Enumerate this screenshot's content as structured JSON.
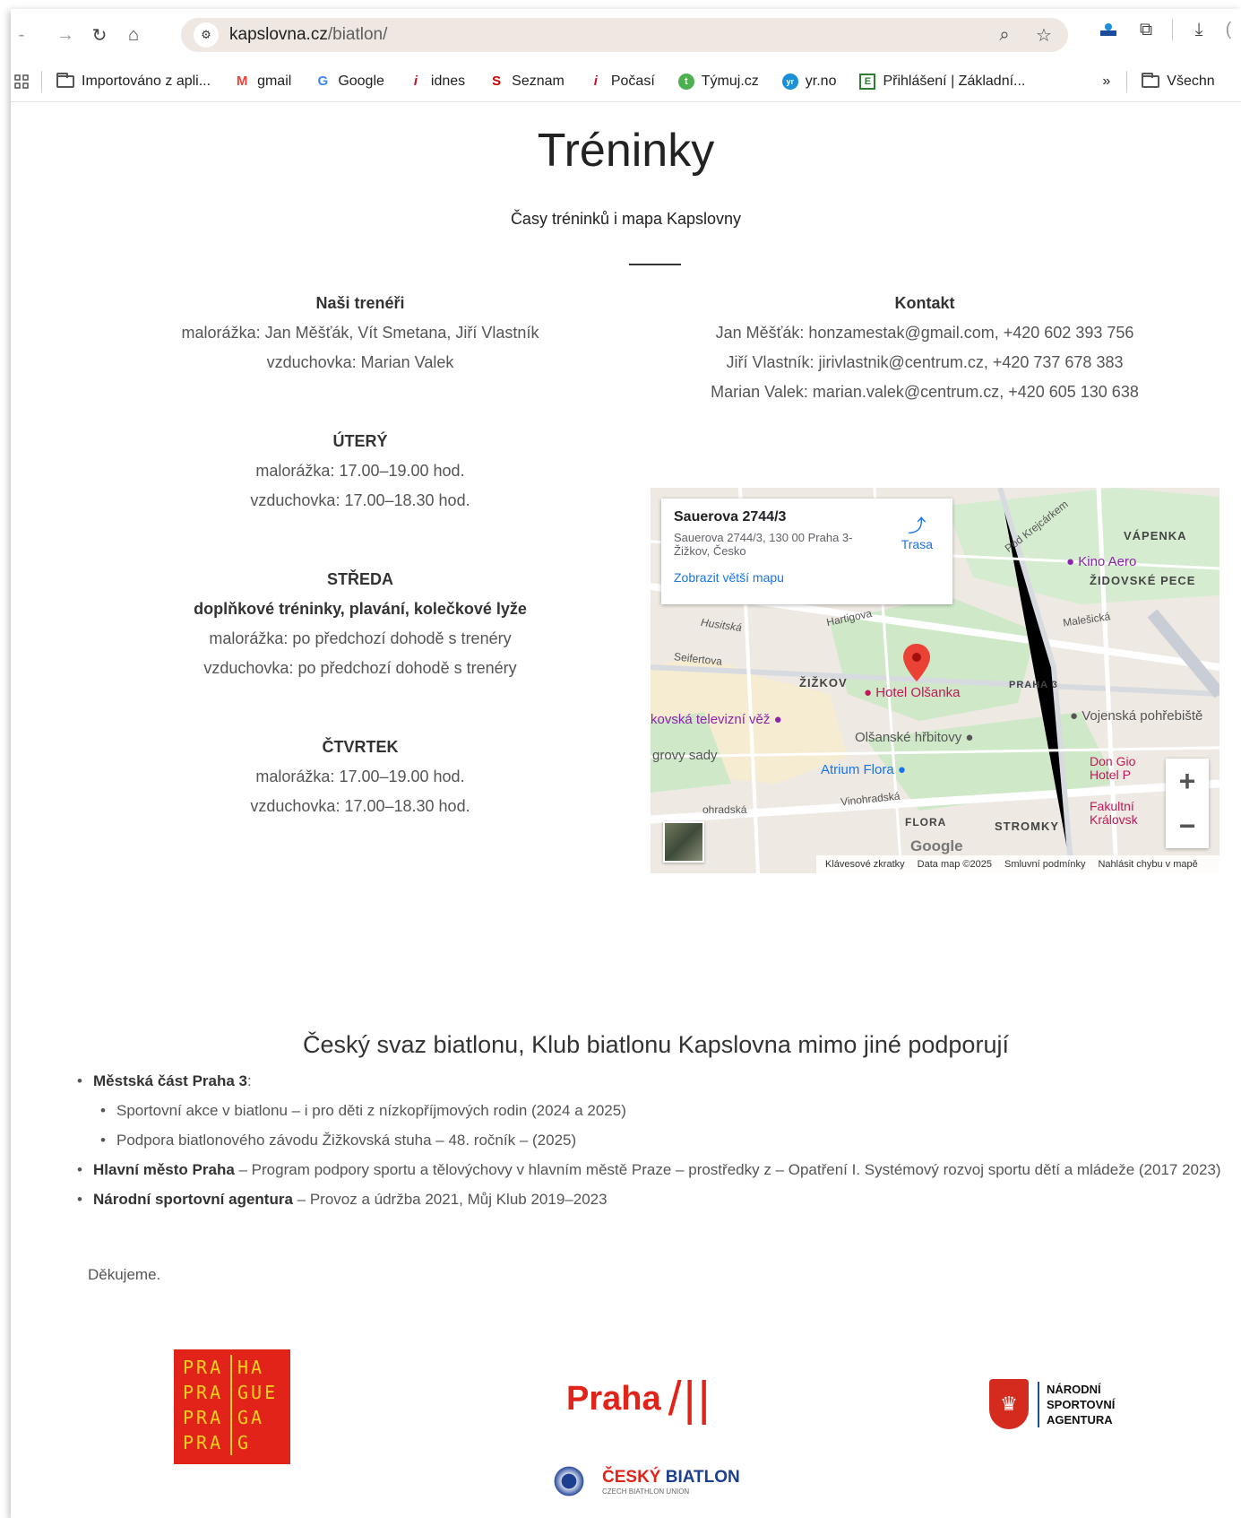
{
  "browser": {
    "url_host": "kapslovna.cz",
    "url_path": "/biatlon/",
    "bookmarks": [
      {
        "label": "Importováno z apli...",
        "icon": "folder-icon"
      },
      {
        "label": "gmail",
        "icon": "gmail-icon"
      },
      {
        "label": "Google",
        "icon": "google-icon"
      },
      {
        "label": "idnes",
        "icon": "idnes-icon"
      },
      {
        "label": "Seznam",
        "icon": "seznam-icon"
      },
      {
        "label": "Počasí",
        "icon": "pocasi-icon"
      },
      {
        "label": "Týmuj.cz",
        "icon": "tymuj-icon"
      },
      {
        "label": "yr.no",
        "icon": "yr-icon"
      },
      {
        "label": "Přihlášení | Základní...",
        "icon": "login-icon"
      }
    ],
    "more_label": "»",
    "all_bookmarks_label": "Všechn"
  },
  "page": {
    "title": "Tréninky",
    "subtitle": "Časy tréninků i mapa Kapslovny"
  },
  "trainers": {
    "heading": "Naši trenéři",
    "line1": "malorážka: Jan Měšťák, Vít Smetana, Jiří Vlastník",
    "line2": "vzduchovka: Marian Valek"
  },
  "contact": {
    "heading": "Kontakt",
    "line1": "Jan Měšťák: honzamestak@gmail.com, +420 602 393 756",
    "line2": "Jiří Vlastník: jirivlastnik@centrum.cz, +420 737 678 383",
    "line3": "Marian Valek: marian.valek@centrum.cz, +420 605 130 638"
  },
  "schedule": {
    "tuesday": {
      "heading": "ÚTERÝ",
      "line1": "malorážka: 17.00–19.00 hod.",
      "line2": "vzduchovka: 17.00–18.30 hod."
    },
    "wednesday": {
      "heading": "STŘEDA",
      "subheading": "doplňkové tréninky, plavání, kolečkové lyže",
      "line1": "malorážka: po předchozí dohodě s trenéry",
      "line2": "vzduchovka: po předchozí dohodě s trenéry"
    },
    "thursday": {
      "heading": "ČTVRTEK",
      "line1": "malorážka: 17.00–19.00 hod.",
      "line2": "vzduchovka: 17.00–18.30 hod."
    }
  },
  "map": {
    "card_title": "Sauerova 2744/3",
    "card_address": "Sauerova 2744/3, 130 00 Praha 3-Žižkov, Česko",
    "card_link": "Zobrazit větší mapu",
    "directions_label": "Trasa",
    "labels": {
      "vapenka": "VÁPENKA",
      "kino": "Kino Aero",
      "zidovske": "ŽIDOVSKÉ PECE",
      "podkrejcarkem": "Pod Krejcárkem",
      "hartigova": "Hartigova",
      "husitska": "Husitská",
      "malesicka": "Malešická",
      "seifertova": "Seifertova",
      "zizkov": "ŽIŽKOV",
      "hotel": "Hotel Olšanka",
      "praha3": "PRAHA 3",
      "tvvez": "kovská televizní věž",
      "vojenska": "Vojenská pohřebiště",
      "olsanske": "Olšanské hřbitovy",
      "grovy": "grovy sady",
      "atrium": "Atrium Flora",
      "dongio": "Don Gio Hotel P",
      "vinohradska": "Vinohradská",
      "ohradska": "ohradská",
      "flora": "FLORA",
      "stromky": "STROMKY",
      "fakultni": "Fakultní Královsk",
      "google": "Google"
    },
    "footer": [
      "Klávesové zkratky",
      "Data map ©2025",
      "Smluvní podmínky",
      "Nahlásit chybu v mapě"
    ],
    "zoom_in": "+",
    "zoom_out": "−"
  },
  "supporters": {
    "title": "Český svaz biatlonu, Klub biatlonu Kapslovna mimo jiné podporují",
    "items": [
      {
        "bold": "Městská část Praha 3",
        "rest": ":"
      },
      {
        "sub": "Sportovní akce v biatlonu – i pro děti z nízkopříjmových rodin (2024 a 2025)"
      },
      {
        "sub": "Podpora biatlonového závodu Žižkovská stuha – 48. ročník – (2025)"
      },
      {
        "bold": "Hlavní město Praha",
        "rest": " – Program podpory sportu a tělovýchovy v hlavním městě Praze – prostředky z – Opatření I. Systémový rozvoj sportu dětí a mládeže (2017 2023)"
      },
      {
        "bold": "Národní sportovní agentura",
        "rest": " – Provoz a údržba 2021, Můj Klub 2019–2023"
      }
    ],
    "thanks": "Děkujeme."
  },
  "logos": {
    "praha_box": [
      [
        "PRA",
        "HA"
      ],
      [
        "PRA",
        "GUE"
      ],
      [
        "PRA",
        "GA"
      ],
      [
        "PRA",
        "G"
      ]
    ],
    "praha_word": "Praha",
    "praha_slashes": "/||",
    "nsa_lines": [
      "NÁRODNÍ",
      "SPORTOVNÍ",
      "AGENTURA"
    ],
    "biathlon_cesky": "ČESKÝ",
    "biathlon_word": "BIATLON",
    "biathlon_sub": "CZECH BIATHLON UNION"
  }
}
